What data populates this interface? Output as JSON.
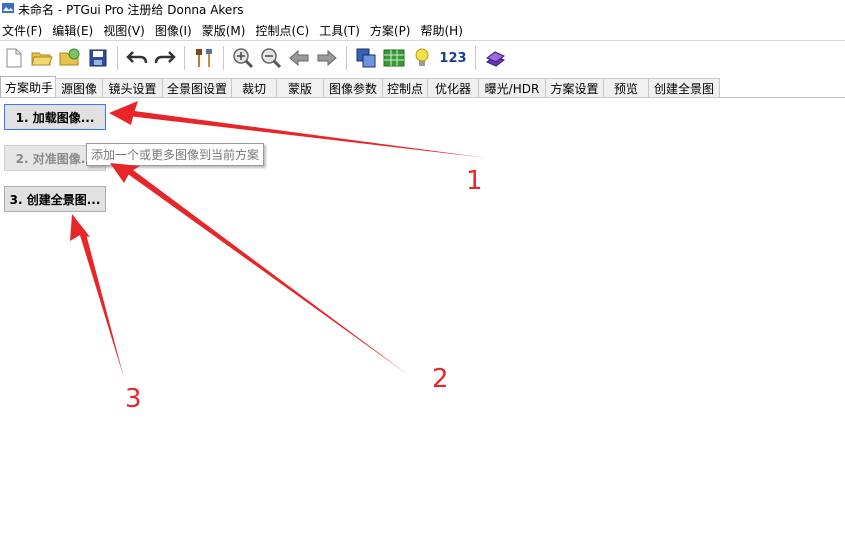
{
  "window": {
    "title": "未命名 - PTGui Pro 注册给 Donna Akers"
  },
  "menu": [
    {
      "id": "file",
      "label": "文件(F)"
    },
    {
      "id": "edit",
      "label": "编辑(E)"
    },
    {
      "id": "view",
      "label": "视图(V)"
    },
    {
      "id": "image",
      "label": "图像(I)"
    },
    {
      "id": "mask",
      "label": "蒙版(M)"
    },
    {
      "id": "controlpoints",
      "label": "控制点(C)"
    },
    {
      "id": "tools",
      "label": "工具(T)"
    },
    {
      "id": "project",
      "label": "方案(P)"
    },
    {
      "id": "help",
      "label": "帮助(H)"
    }
  ],
  "toolbar": {
    "icons": [
      "new-document-icon",
      "open-folder-icon",
      "open-recent-icon",
      "save-icon",
      "undo-icon",
      "redo-icon",
      "tools-icon",
      "zoom-in-icon",
      "zoom-out-icon",
      "back-icon",
      "forward-icon",
      "panorama-editor-icon",
      "table-icon",
      "lightbulb-icon",
      "numbers-icon",
      "book-icon"
    ],
    "numbers_label": "123"
  },
  "tabs": [
    "方案助手",
    "源图像",
    "镜头设置",
    "全景图设置",
    "裁切",
    "蒙版",
    "图像参数",
    "控制点",
    "优化器",
    "曝光/HDR",
    "方案设置",
    "预览",
    "创建全景图"
  ],
  "active_tab": 0,
  "buttons": {
    "load": "1. 加载图像...",
    "align": "2. 对准图像...",
    "create": "3. 创建全景图..."
  },
  "tooltip": "添加一个或更多图像到当前方案",
  "annotations": {
    "color": "#e8262a",
    "labels": [
      "1",
      "2",
      "3"
    ]
  }
}
